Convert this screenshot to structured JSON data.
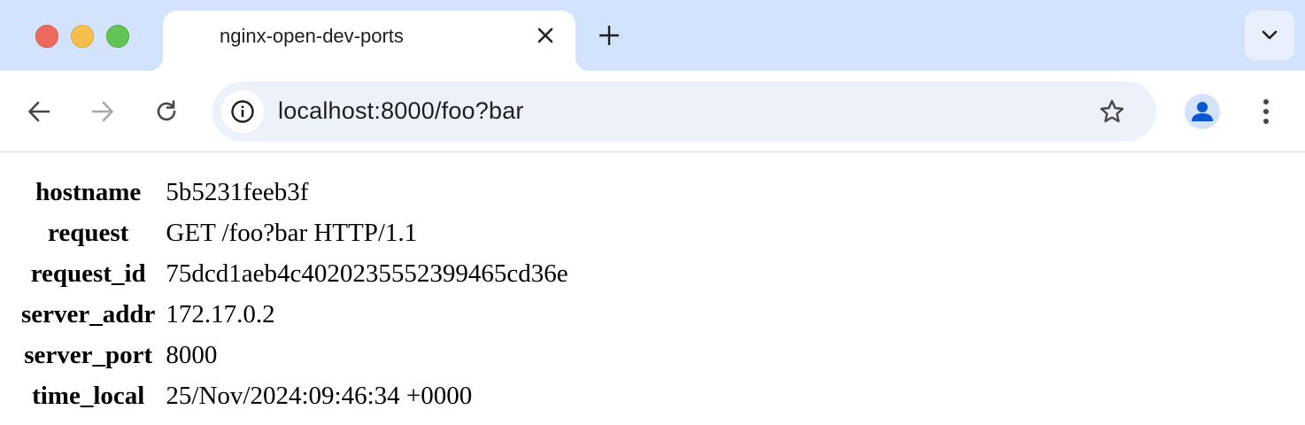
{
  "browser": {
    "tab": {
      "title": "nginx-open-dev-ports"
    },
    "address_bar": {
      "url": "localhost:8000/foo?bar"
    },
    "icons": [
      "close-red",
      "minimize-yellow",
      "zoom-green",
      "close-icon",
      "plus-icon",
      "chevron-down-icon",
      "back-arrow-icon",
      "forward-arrow-icon",
      "reload-icon",
      "info-icon",
      "star-icon",
      "profile-icon",
      "kebab-menu-icon"
    ]
  },
  "page": {
    "rows": [
      {
        "key": "hostname",
        "value": "5b5231feeb3f"
      },
      {
        "key": "request",
        "value": "GET /foo?bar HTTP/1.1"
      },
      {
        "key": "request_id",
        "value": "75dcd1aeb4c4020235552399465cd36e"
      },
      {
        "key": "server_addr",
        "value": "172.17.0.2"
      },
      {
        "key": "server_port",
        "value": "8000"
      },
      {
        "key": "time_local",
        "value": "25/Nov/2024:09:46:34 +0000"
      }
    ]
  },
  "colors": {
    "tabstrip": "#d3e3fd",
    "omnibox": "#edf2fa",
    "profile_accent": "#0b57d0"
  }
}
